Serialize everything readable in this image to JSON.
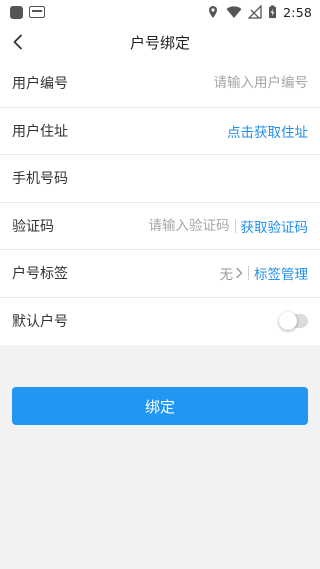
{
  "status_bar": {
    "time": "2:58",
    "left_icons": [
      "app-notification-icon",
      "news-notification-icon"
    ],
    "right_icons": [
      "location-icon",
      "wifi-icon",
      "no-signal-icon",
      "battery-charging-icon"
    ]
  },
  "header": {
    "title": "户号绑定",
    "back_icon": "back-chevron-icon"
  },
  "form": {
    "user_number": {
      "label": "用户编号",
      "placeholder": "请输入用户编号",
      "value": ""
    },
    "address": {
      "label": "用户住址",
      "action": "点击获取住址"
    },
    "phone": {
      "label": "手机号码",
      "value": ""
    },
    "code": {
      "label": "验证码",
      "placeholder": "请输入验证码",
      "value": "",
      "action": "获取验证码"
    },
    "tag": {
      "label": "户号标签",
      "value": "无",
      "action": "标签管理"
    },
    "default": {
      "label": "默认户号",
      "enabled": false
    }
  },
  "bind_button": {
    "label": "绑定"
  },
  "colors": {
    "accent": "#2196f3",
    "link": "#1e8ff0",
    "background": "#f2f2f2"
  }
}
